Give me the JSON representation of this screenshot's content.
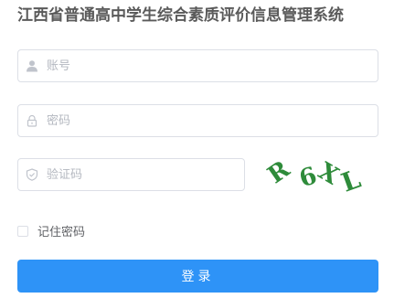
{
  "page": {
    "title": "江西省普通高中学生综合素质评价信息管理系统"
  },
  "form": {
    "account": {
      "placeholder": "账号",
      "icon": "user-icon"
    },
    "password": {
      "placeholder": "密码",
      "icon": "lock-icon"
    },
    "captcha": {
      "placeholder": "验证码",
      "icon": "shield-icon",
      "image_text": "R6XL"
    },
    "remember_label": "记住密码",
    "login_label": "登录"
  },
  "colors": {
    "primary": "#2e93f7",
    "border": "#dcdfe6",
    "placeholder": "#b4b8c0",
    "title": "#5a5a5a",
    "captcha_text": "#2e8b3a"
  }
}
